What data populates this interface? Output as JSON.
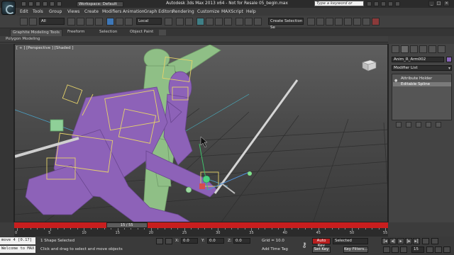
{
  "window": {
    "workspace_label": "Workspace: Default",
    "title": "Autodesk 3ds Max  2013 x64  -  Not for Resale    05_begin.max",
    "search_placeholder": "Type a keyword or phrase"
  },
  "menu": [
    "Edit",
    "Tools",
    "Group",
    "Views",
    "Create",
    "Modifiers",
    "Animation",
    "Graph Editors",
    "Rendering",
    "Customize",
    "MAXScript",
    "Help"
  ],
  "toolbar": {
    "filter_dropdown": "All",
    "ref_coord_dropdown": "Local",
    "selection_set_dropdown": "Create Selection Se"
  },
  "ribbon": {
    "tabs": [
      "Graphite Modeling Tools",
      "Freeform",
      "Selection",
      "Object Paint"
    ],
    "active_tab": 0,
    "sub_label": "Polygon Modeling"
  },
  "viewport": {
    "label": "[ + ] [Perspective ] [Shaded ]"
  },
  "command_panel": {
    "object_name": "Anim_R_Arm002",
    "object_color": "#8a66bb",
    "modifier_list_label": "Modifier List",
    "stack": [
      "Attribute Holder",
      "Editable Spline"
    ],
    "selected_stack_index": 1
  },
  "timeline": {
    "slider_label": "15 / 55",
    "current_frame": 15,
    "total_frames": 55,
    "ticks": [
      "0",
      "5",
      "10",
      "15",
      "20",
      "25",
      "30",
      "35",
      "40",
      "45",
      "50",
      "55"
    ]
  },
  "status": {
    "listener_line1": "move 4 [0.17]",
    "listener_line2": "Welcome to MAX",
    "selection_text": "1 Shape Selected",
    "prompt_text": "Click and drag to select and move objects",
    "coords": [
      {
        "axis": "X:",
        "value": "0.0"
      },
      {
        "axis": "Y:",
        "value": "0.0"
      },
      {
        "axis": "Z:",
        "value": "0.0"
      }
    ],
    "grid_text": "Grid = 10.0",
    "add_time_tag": "Add Time Tag",
    "auto_key": "Auto Key",
    "set_key": "Set Key",
    "selected_dropdown": "Selected",
    "key_filters": "Key Filters...",
    "frame_value": "15",
    "accent_red": "#c81e1e"
  }
}
